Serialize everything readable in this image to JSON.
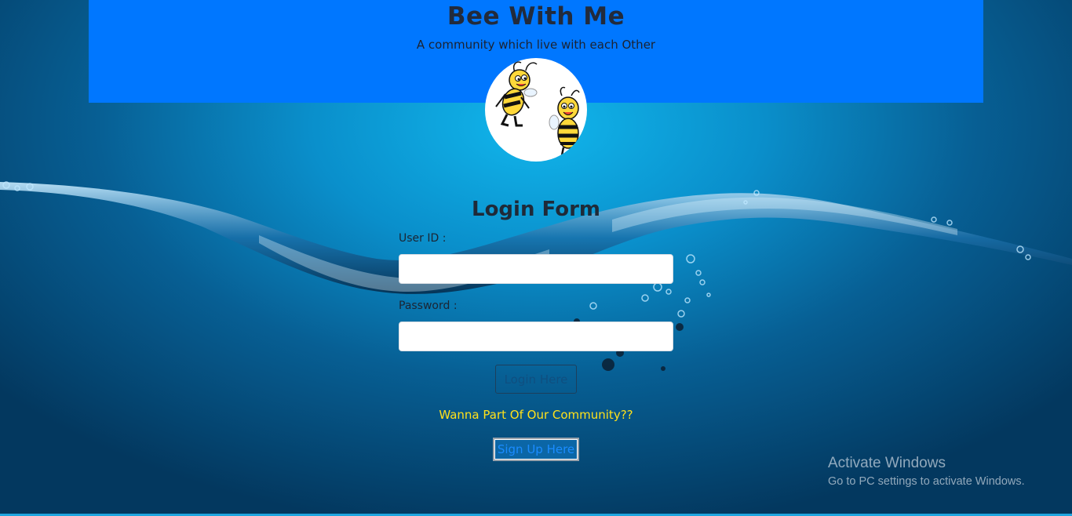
{
  "header": {
    "title": "Bee With Me",
    "tagline": "A community which live with each Other",
    "background_color": "#0077ff",
    "logo_icon": "bees-logo-icon"
  },
  "login_form": {
    "title": "Login Form",
    "user_id_label": "User ID :",
    "user_id_value": "",
    "password_label": "Password :",
    "password_value": "",
    "login_button_label": "Login Here"
  },
  "signup": {
    "prompt": "Wanna Part Of Our Community??",
    "prompt_color": "#ffe11a",
    "button_label": "Sign Up Here"
  },
  "watermark": {
    "title": "Activate Windows",
    "subtitle": "Go to PC settings to activate Windows."
  }
}
